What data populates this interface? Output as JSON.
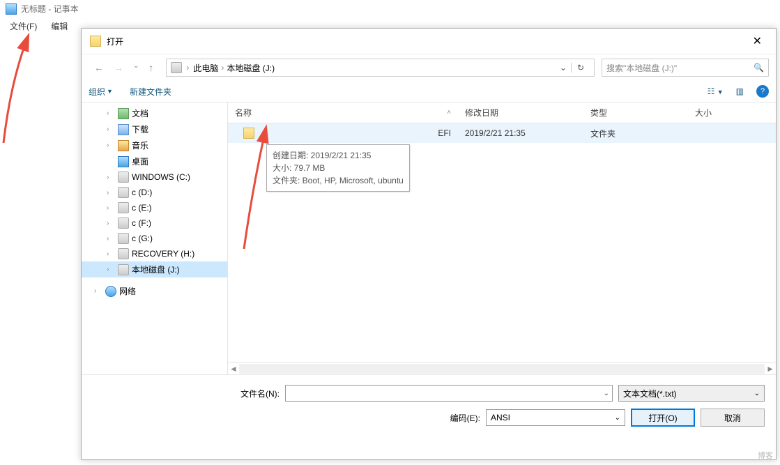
{
  "notepad": {
    "title": "无标题 - 记事本",
    "menu": {
      "file": "文件(F)",
      "edit": "编辑"
    }
  },
  "dialog": {
    "title": "打开",
    "breadcrumb": {
      "pc": "此电脑",
      "drive": "本地磁盘 (J:)"
    },
    "search_placeholder": "搜索\"本地磁盘 (J:)\"",
    "toolbar": {
      "organize": "组织",
      "newfolder": "新建文件夹"
    },
    "tree": {
      "docs": "文档",
      "downloads": "下载",
      "music": "音乐",
      "desktop": "桌面",
      "winc": "WINDOWS (C:)",
      "cd": "c (D:)",
      "ce": "c (E:)",
      "cf": "c (F:)",
      "cg": "c (G:)",
      "recovery": "RECOVERY (H:)",
      "localj": "本地磁盘 (J:)",
      "network": "网络"
    },
    "columns": {
      "name": "名称",
      "date": "修改日期",
      "type": "类型",
      "size": "大小"
    },
    "row": {
      "name": "EFI",
      "date": "2019/2/21 21:35",
      "type": "文件夹"
    },
    "tooltip": {
      "l1": "创建日期: 2019/2/21 21:35",
      "l2": "大小: 79.7 MB",
      "l3": "文件夹: Boot, HP, Microsoft, ubuntu"
    },
    "form": {
      "filename_label": "文件名(N):",
      "filetype": "文本文档(*.txt)",
      "encoding_label": "编码(E):",
      "encoding": "ANSI",
      "open": "打开(O)",
      "cancel": "取消"
    }
  },
  "watermark": "博客"
}
